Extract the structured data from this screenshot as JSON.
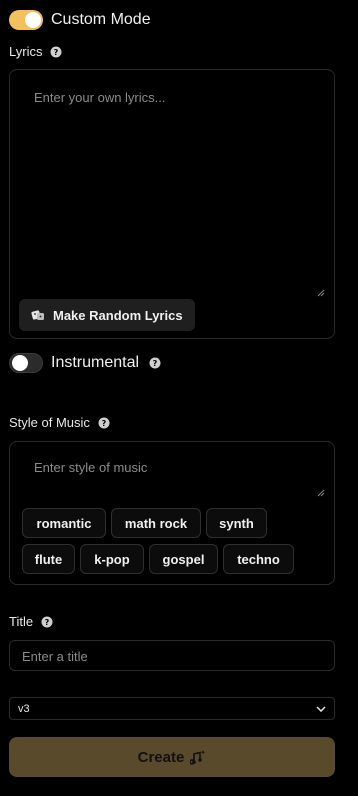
{
  "custom_mode": {
    "label": "Custom Mode",
    "enabled": true
  },
  "lyrics": {
    "label": "Lyrics",
    "placeholder": "Enter your own lyrics...",
    "random_button_label": "Make Random Lyrics"
  },
  "instrumental": {
    "label": "Instrumental",
    "enabled": false
  },
  "style_of_music": {
    "label": "Style of Music",
    "placeholder": "Enter style of music",
    "chips": [
      "romantic",
      "math rock",
      "synth",
      "flute",
      "k-pop",
      "gospel",
      "techno"
    ]
  },
  "title": {
    "label": "Title",
    "placeholder": "Enter a title"
  },
  "model_select": {
    "value": "v3"
  },
  "create_button": {
    "label": "Create"
  },
  "colors": {
    "accent": "#f2c15e",
    "create_bg": "#5a4a2c"
  },
  "icons": {
    "help": "question-circle-icon",
    "random": "dice-icon",
    "create": "music-sparkle-icon",
    "dropdown": "chevron-down-icon"
  }
}
